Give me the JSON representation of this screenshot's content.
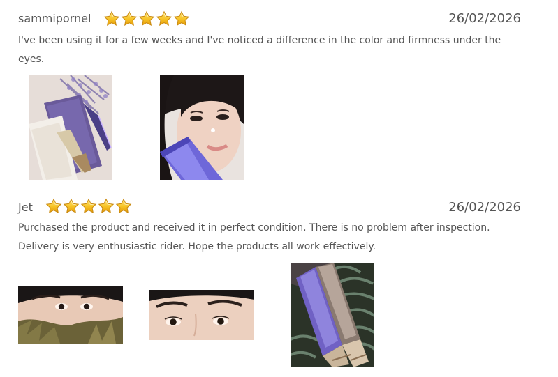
{
  "reviews": [
    {
      "author": "sammipornel",
      "rating": 5,
      "date": "26/02/2026",
      "text": "I've been using it for a few weeks and I've noticed a difference in the color and firmness under the eyes.",
      "photos": [
        "product-flatlay-photo",
        "selfie-with-tube-photo"
      ]
    },
    {
      "author": "Jet",
      "rating": 5,
      "date": "26/02/2026",
      "text": "Purchased the product and received it in perfect condition. There is no problem after inspection. Delivery is very enthusiastic rider. Hope the products all work effectively.",
      "photos": [
        "eyes-closeup-photo-1",
        "eyes-closeup-photo-2",
        "product-tubes-photo"
      ]
    }
  ],
  "colors": {
    "star": "#f7c325",
    "divider": "#d9d9d9",
    "text": "#555555"
  }
}
